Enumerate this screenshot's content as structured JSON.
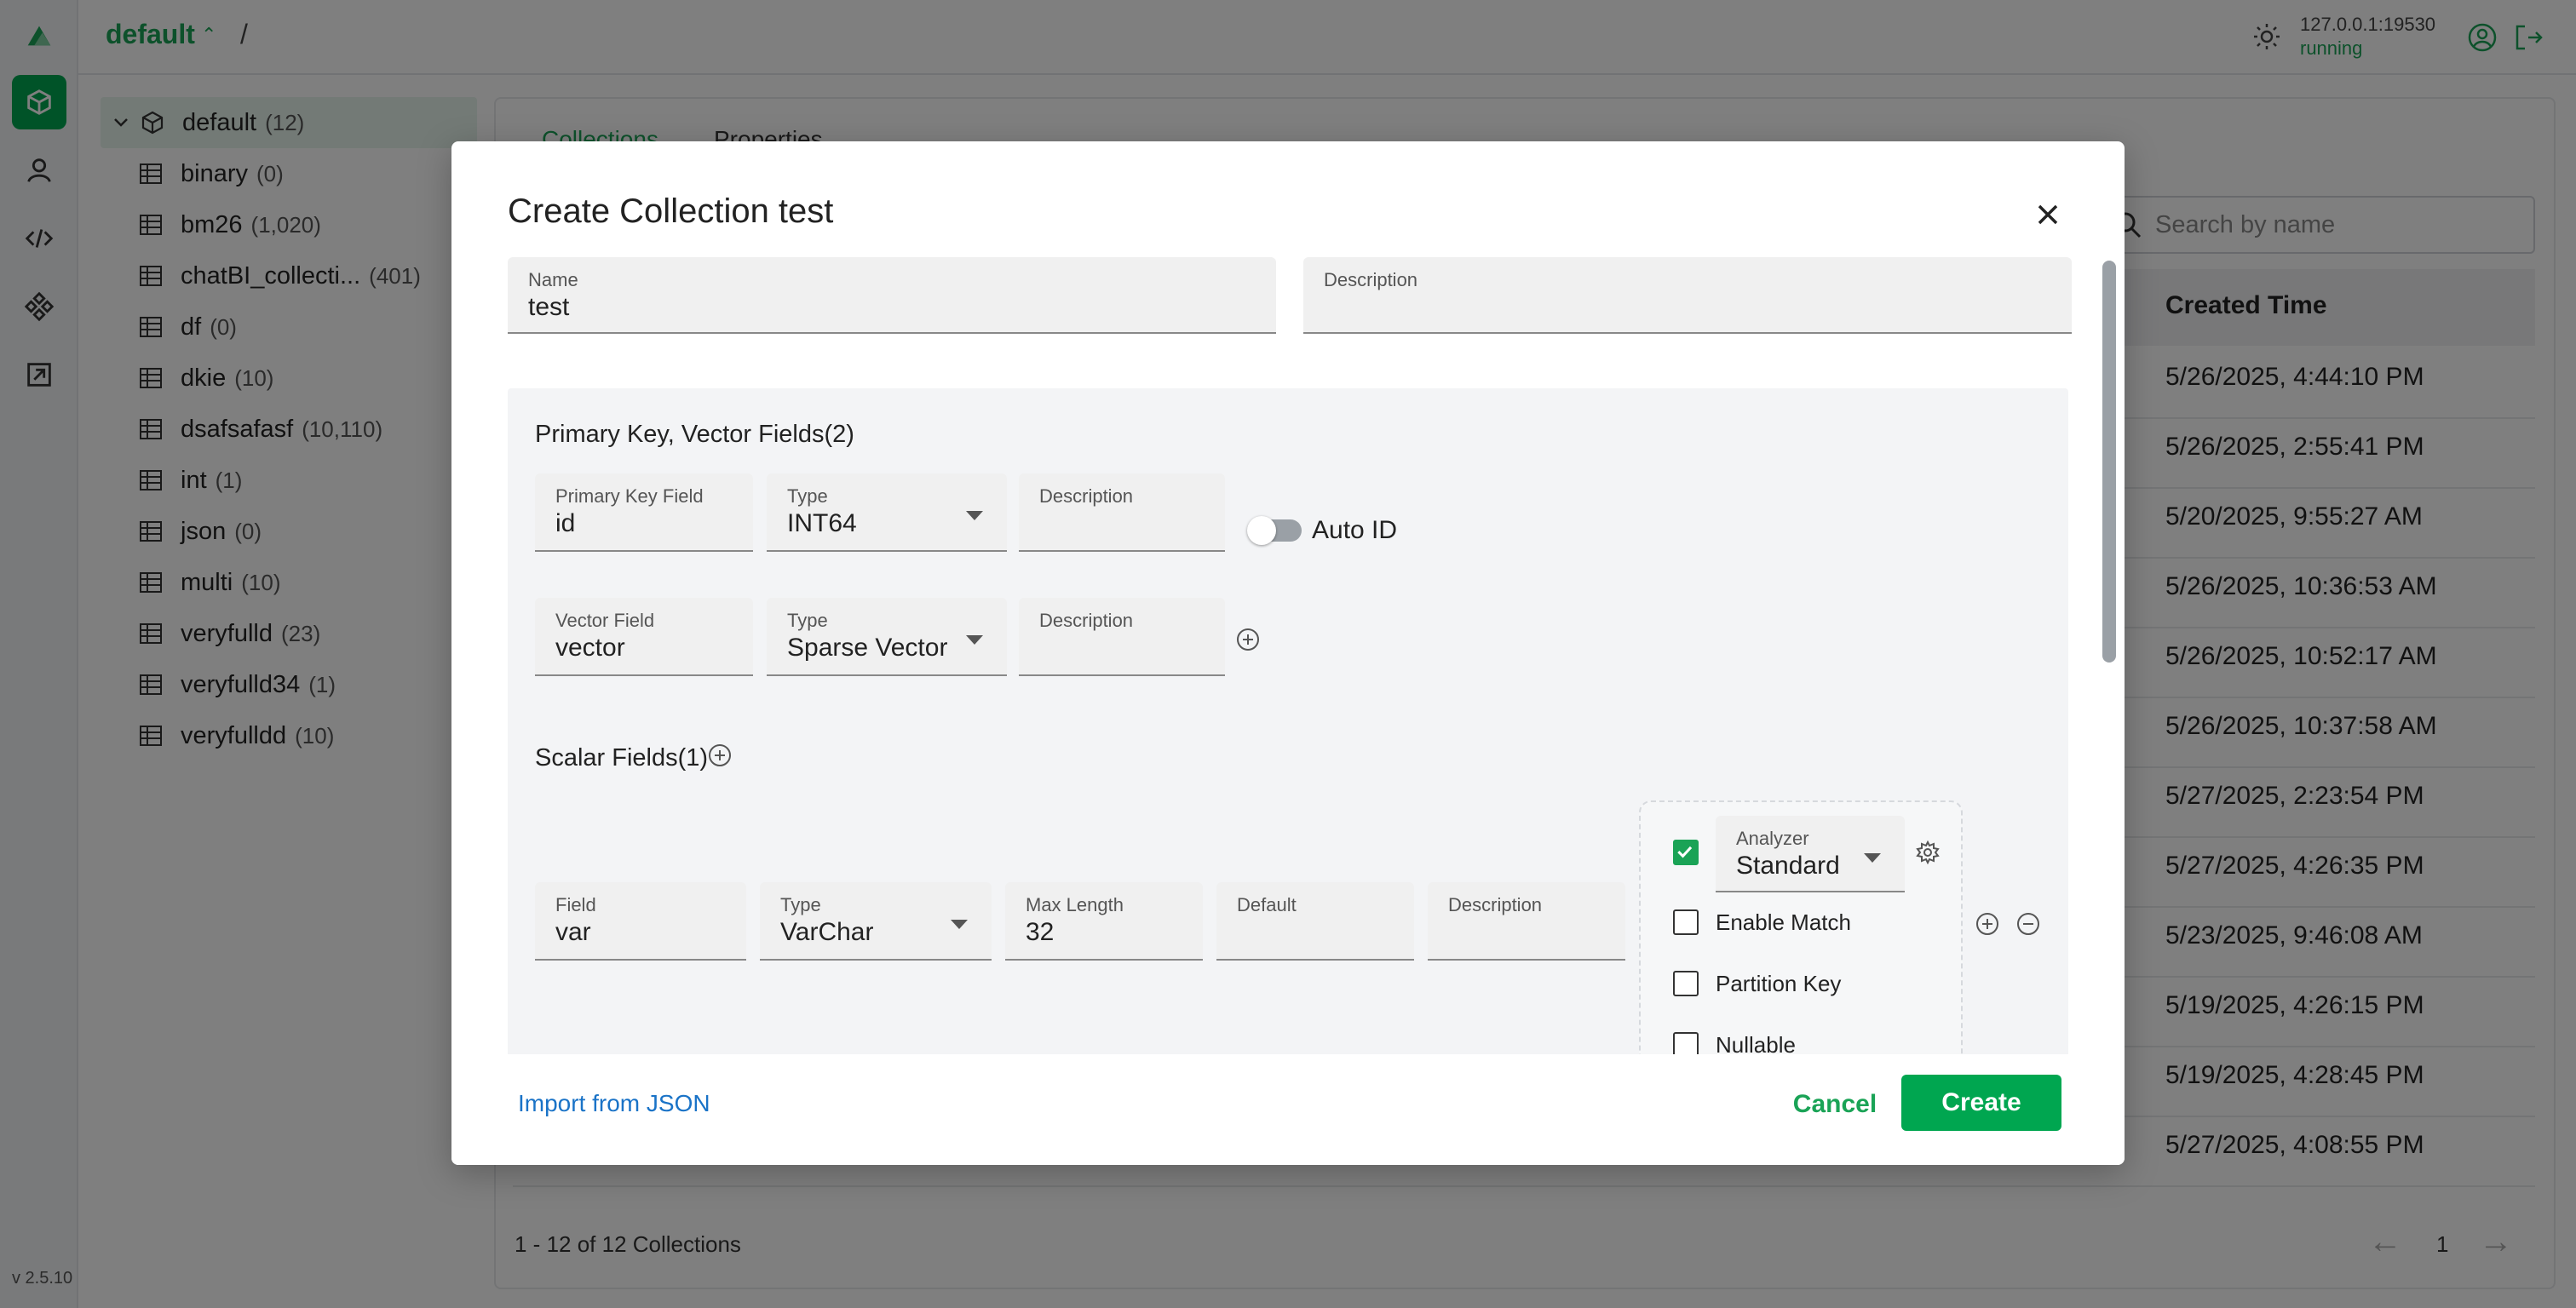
{
  "header": {
    "database": "default",
    "separator": "/",
    "server_address": "127.0.0.1:19530",
    "server_status": "running"
  },
  "rail": {
    "items": [
      "database-icon",
      "user-icon",
      "code-icon",
      "system-icon",
      "import-icon"
    ],
    "version": "v 2.5.10"
  },
  "tree": {
    "root": {
      "name": "default",
      "count": "(12)"
    },
    "items": [
      {
        "name": "binary",
        "count": "(0)"
      },
      {
        "name": "bm26",
        "count": "(1,020)"
      },
      {
        "name": "chatBI_collecti...",
        "count": "(401)"
      },
      {
        "name": "df",
        "count": "(0)"
      },
      {
        "name": "dkie",
        "count": "(10)"
      },
      {
        "name": "dsafsafasf",
        "count": "(10,110)"
      },
      {
        "name": "int",
        "count": "(1)"
      },
      {
        "name": "json",
        "count": "(0)"
      },
      {
        "name": "multi",
        "count": "(10)"
      },
      {
        "name": "veryfulld",
        "count": "(23)"
      },
      {
        "name": "veryfulld34",
        "count": "(1)"
      },
      {
        "name": "veryfulldd",
        "count": "(10)"
      }
    ]
  },
  "main": {
    "tabs": [
      "Collections",
      "Properties"
    ],
    "search_placeholder": "Search by name",
    "column_created": "Created Time",
    "created_times": [
      "5/26/2025, 4:44:10 PM",
      "5/26/2025, 2:55:41 PM",
      "5/20/2025, 9:55:27 AM",
      "5/26/2025, 10:36:53 AM",
      "5/26/2025, 10:52:17 AM",
      "5/26/2025, 10:37:58 AM",
      "5/27/2025, 2:23:54 PM",
      "5/27/2025, 4:26:35 PM",
      "5/23/2025, 9:46:08 AM",
      "5/19/2025, 4:26:15 PM",
      "5/19/2025, 4:28:45 PM",
      "5/27/2025, 4:08:55 PM"
    ],
    "footer_count": "1 - 12 of 12 Collections",
    "page": "1"
  },
  "modal": {
    "title": "Create Collection test",
    "name_label": "Name",
    "name_value": "test",
    "description_label": "Description",
    "pk_section_title": "Primary Key, Vector Fields(2)",
    "pk_field_label": "Primary Key Field",
    "pk_field_value": "id",
    "type_label": "Type",
    "pk_type_value": "INT64",
    "auto_id_label": "Auto ID",
    "vector_field_label": "Vector Field",
    "vector_field_value": "vector",
    "vector_type_value": "Sparse Vector",
    "scalar_section_title": "Scalar Fields(1)",
    "scalar_field_label": "Field",
    "scalar_field_value": "var",
    "scalar_type_value": "VarChar",
    "max_length_label": "Max Length",
    "max_length_value": "32",
    "default_label": "Default",
    "analyzer_label": "Analyzer",
    "analyzer_value": "Standard",
    "enable_match_label": "Enable Match",
    "partition_key_label": "Partition Key",
    "nullable_label": "Nullable",
    "import_json": "Import from JSON",
    "cancel": "Cancel",
    "create": "Create"
  },
  "colors": {
    "accent": "#00a650",
    "link": "#1a73c7"
  }
}
